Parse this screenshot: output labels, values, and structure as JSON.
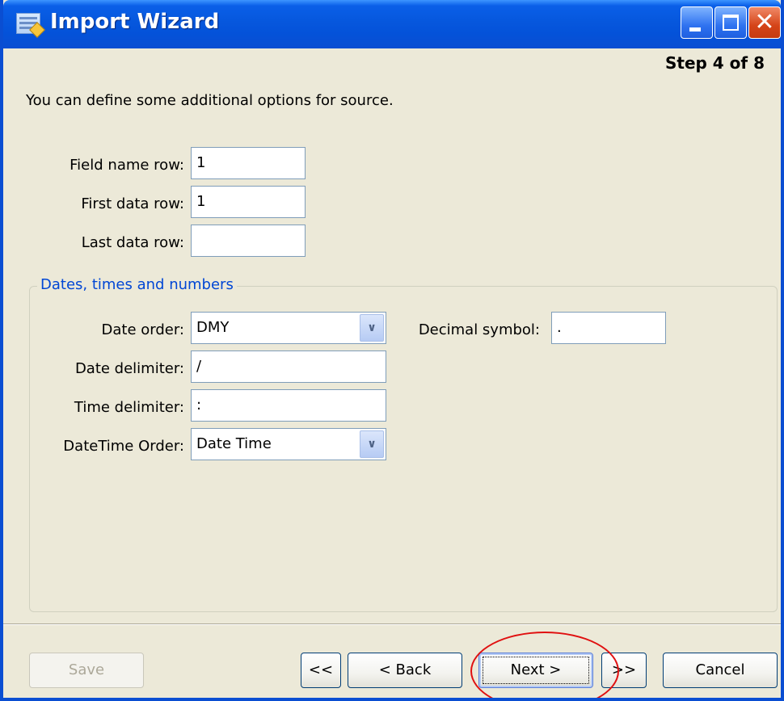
{
  "window": {
    "title": "Import Wizard",
    "accent_color": "#0a4ed2",
    "icon": "import-wizard-icon"
  },
  "step_indicator": "Step 4 of 8",
  "intro_text": "You can define some additional options for source.",
  "rows": {
    "field_name_row": {
      "label": "Field name row:",
      "value": "1"
    },
    "first_data_row": {
      "label": "First data row:",
      "value": "1"
    },
    "last_data_row": {
      "label": "Last data row:",
      "value": ""
    }
  },
  "group": {
    "legend": "Dates, times and numbers",
    "legend_color": "#0046d5",
    "date_order": {
      "label": "Date order:",
      "value": "DMY"
    },
    "date_delimiter": {
      "label": "Date delimiter:",
      "value": "/"
    },
    "time_delimiter": {
      "label": "Time delimiter:",
      "value": ":"
    },
    "datetime_order": {
      "label": "DateTime Order:",
      "value": "Date Time"
    },
    "decimal_symbol": {
      "label": "Decimal symbol:",
      "value": "."
    }
  },
  "buttons": {
    "save": "Save",
    "first": "<<",
    "back": "< Back",
    "next": "Next >",
    "last": ">>",
    "cancel": "Cancel"
  },
  "annotation": {
    "highlight_color": "#e01010"
  }
}
